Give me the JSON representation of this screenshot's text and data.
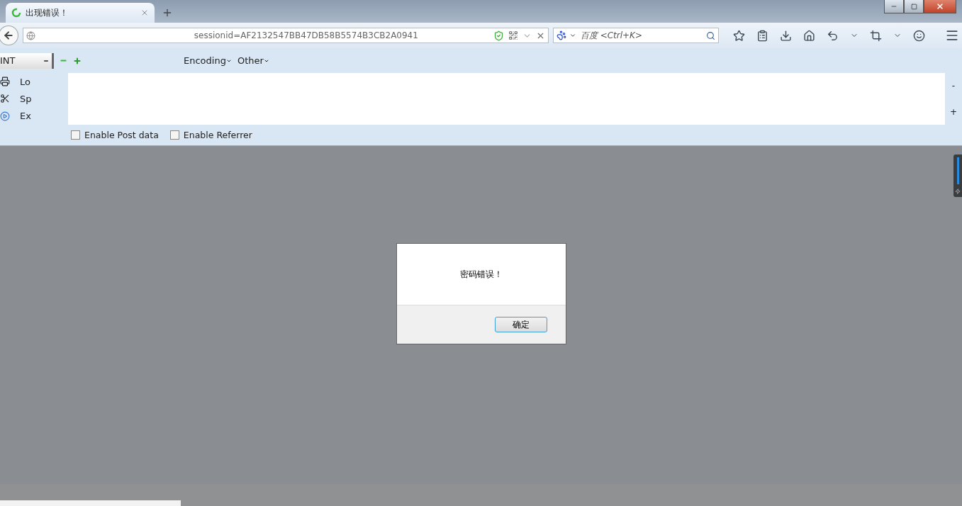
{
  "tabs": [
    {
      "title": "出现错误！",
      "selected": true
    }
  ],
  "address_bar": {
    "value": "sessionid=AF2132547BB47DB58B5574B3CB2A0941"
  },
  "search": {
    "placeholder": "百度 <Ctrl+K>"
  },
  "hackbar": {
    "select": "INT",
    "menus": [
      "Encoding",
      "Other"
    ],
    "actions": [
      {
        "label": "Lo",
        "kind": "print"
      },
      {
        "label": "Sp",
        "kind": "split"
      },
      {
        "label": "Ex",
        "kind": "play"
      }
    ],
    "side_buttons": [
      "-",
      "+"
    ],
    "options": [
      {
        "label": "Enable Post data",
        "checked": false
      },
      {
        "label": "Enable Referrer",
        "checked": false
      }
    ]
  },
  "dialog": {
    "message": "密码错误！",
    "button": "确定"
  }
}
